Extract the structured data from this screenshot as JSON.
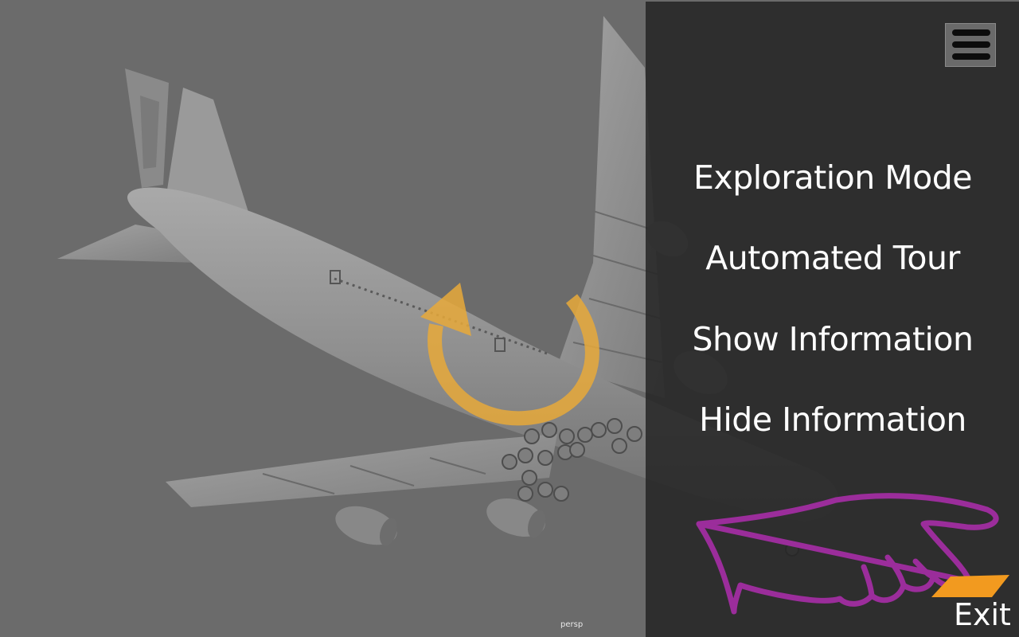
{
  "viewport": {
    "camera_label": "persp"
  },
  "menu": {
    "items": [
      {
        "label": "Exploration Mode"
      },
      {
        "label": "Automated Tour"
      },
      {
        "label": "Show Information"
      },
      {
        "label": "Hide Information"
      }
    ]
  },
  "exit": {
    "label": "Exit"
  },
  "icons": {
    "menu": "hamburger-icon",
    "rotate": "rotate-arrow-icon",
    "pointer": "pointing-hand-icon",
    "exit": "exit-arrow-icon"
  },
  "colors": {
    "viewport_bg": "#6b6b6b",
    "panel_bg": "#2a2a2a",
    "rotate_arrow": "#e8a93a",
    "hand_outline": "#9b2d9b",
    "exit_accent": "#f29a1f"
  }
}
